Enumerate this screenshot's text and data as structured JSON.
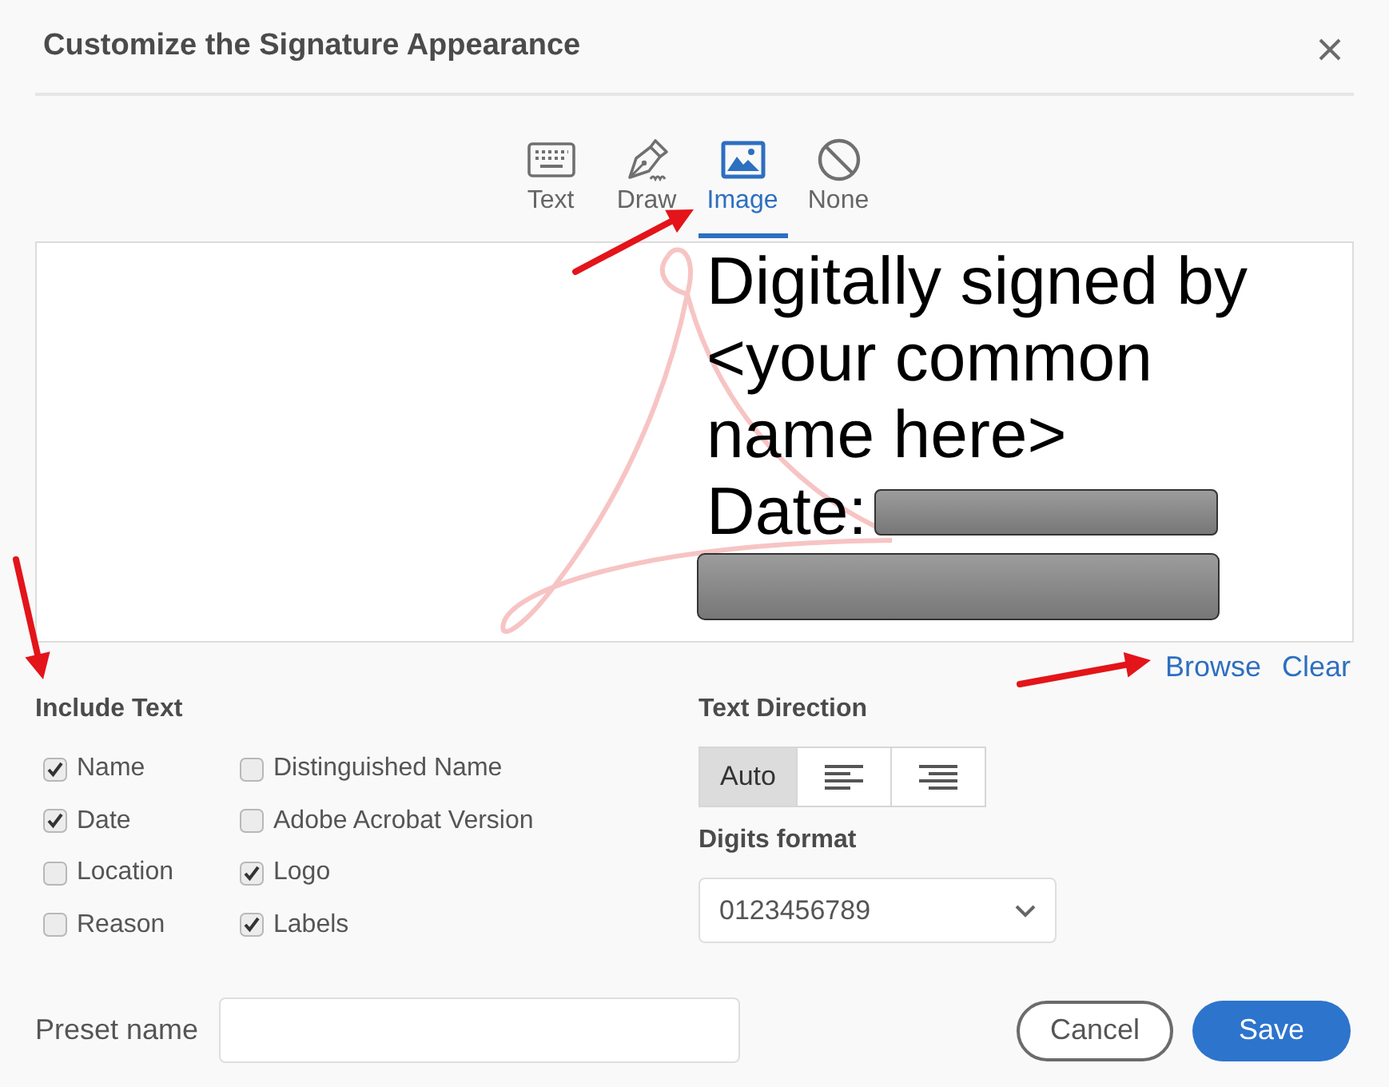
{
  "dialog": {
    "title": "Customize the Signature Appearance"
  },
  "tabs": [
    {
      "kind": "text",
      "label": "Text",
      "selected": false
    },
    {
      "kind": "draw",
      "label": "Draw",
      "selected": false
    },
    {
      "kind": "image",
      "label": "Image",
      "selected": true
    },
    {
      "kind": "none",
      "label": "None",
      "selected": false
    }
  ],
  "preview": {
    "signed_by": "Digitally signed by <your common name here>",
    "date_label": "Date:"
  },
  "preview_actions": [
    "Browse",
    "Clear"
  ],
  "include_text": {
    "heading": "Include Text",
    "options": [
      {
        "label": "Name",
        "checked": true
      },
      {
        "label": "Date",
        "checked": true
      },
      {
        "label": "Location",
        "checked": false
      },
      {
        "label": "Reason",
        "checked": false
      },
      {
        "label": "Distinguished Name",
        "checked": false
      },
      {
        "label": "Adobe Acrobat Version",
        "checked": false
      },
      {
        "label": "Logo",
        "checked": true
      },
      {
        "label": "Labels",
        "checked": true
      }
    ]
  },
  "text_direction": {
    "heading": "Text Direction",
    "options": [
      {
        "kind": "auto",
        "label": "Auto",
        "selected": true
      },
      {
        "kind": "left",
        "selected": false
      },
      {
        "kind": "right",
        "selected": false
      }
    ]
  },
  "digits_format": {
    "heading": "Digits format",
    "value": "0123456789"
  },
  "preset_name": {
    "label": "Preset name"
  },
  "buttons": [
    {
      "kind": "secondary",
      "label": "Cancel"
    },
    {
      "kind": "primary",
      "label": "Save"
    }
  ]
}
